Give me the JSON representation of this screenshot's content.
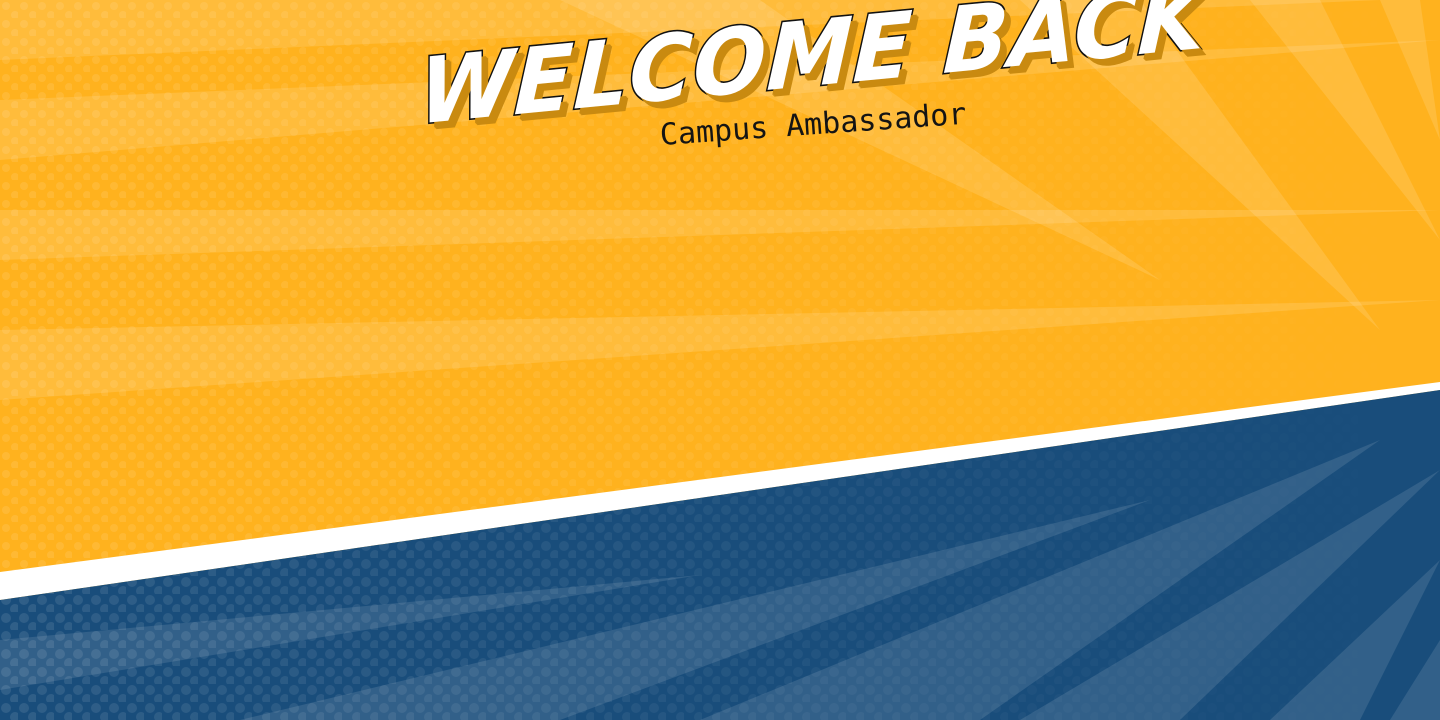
{
  "banner": {
    "headline": "WELCOME BACK",
    "subtitle": "Campus Ambassador"
  },
  "colors": {
    "top_panel": "#ffb21e",
    "bottom_panel": "#194d7b",
    "divider": "#ffffff",
    "headline_fill": "#ffffff",
    "headline_outline": "#111111",
    "subtitle_text": "#141414"
  }
}
